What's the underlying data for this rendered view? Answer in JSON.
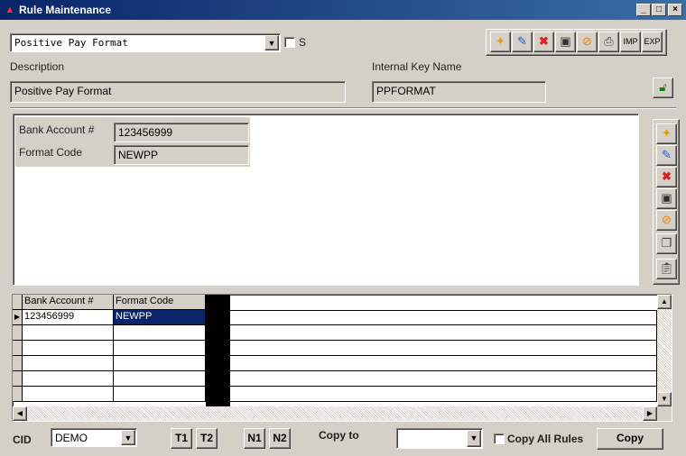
{
  "window": {
    "title": "Rule Maintenance",
    "minimize": "_",
    "maximize": "□",
    "close": "×"
  },
  "rule_select": {
    "value": "Positive Pay Format"
  },
  "s_checkbox": {
    "label": "S"
  },
  "toolbar": {
    "imp": "IMP",
    "exp": "EXP"
  },
  "description": {
    "label": "Description",
    "value": "Positive Pay Format"
  },
  "internal_key": {
    "label": "Internal Key Name",
    "value": "PPFORMAT"
  },
  "detail": {
    "bank_account_label": "Bank Account #",
    "bank_account_value": "123456999",
    "format_code_label": "Format Code",
    "format_code_value": "NEWPP"
  },
  "grid": {
    "columns": [
      "Bank Account #",
      "Format Code"
    ],
    "rows": [
      [
        "123456999",
        "NEWPP"
      ]
    ]
  },
  "bottom": {
    "cid_label": "CID",
    "cid_value": "DEMO",
    "t1": "T1",
    "t2": "T2",
    "n1": "N1",
    "n2": "N2",
    "copy_to_label": "Copy to",
    "copy_to_value": "",
    "copy_all_label": "Copy All Rules",
    "copy_button": "Copy"
  }
}
